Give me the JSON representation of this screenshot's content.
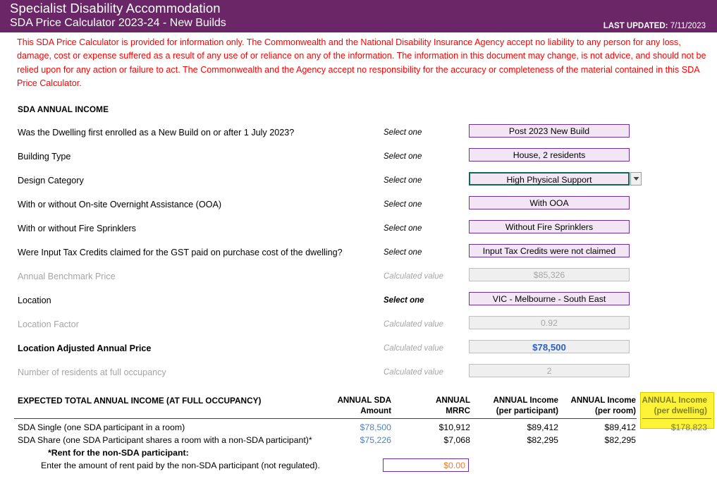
{
  "header": {
    "title": "Specialist Disability Accommodation",
    "subtitle": "SDA Price Calculator 2023-24 - New Builds",
    "last_updated_label": "LAST UPDATED:",
    "last_updated_value": "7/11/2023",
    "banner_color": "#6B2668"
  },
  "disclaimer": "This SDA Price Calculator is provided for information only.  The Commonwealth and the National Disability Insurance Agency accept no liability to any person for any loss, damage, cost or expense suffered as a result of any use of or reliance on any of the information.  The information in this document may change, is not advice, and should not be relied upon for any action or failure to act. The Commonwealth and the Agency accept no responsibility for the accuracy or completeness of the material contained in this SDA Price Calculator.",
  "section": {
    "heading": "SDA ANNUAL INCOME"
  },
  "hints": {
    "select_one": "Select one",
    "calculated_value": "Calculated value"
  },
  "form_rows": [
    {
      "label": "Was the Dwelling first enrolled as a New Build on or after 1 July 2023?",
      "hint": "Select one",
      "value": "Post 2023 New Build"
    },
    {
      "label": "Building Type",
      "hint": "Select one",
      "value": "House, 2 residents"
    },
    {
      "label": "Design Category",
      "hint": "Select one",
      "value": "High Physical Support"
    },
    {
      "label": "With or without On-site Overnight Assistance (OOA)",
      "hint": "Select one",
      "value": "With OOA"
    },
    {
      "label": "With or without Fire Sprinklers",
      "hint": "Select one",
      "value": "Without Fire Sprinklers"
    },
    {
      "label": "Were Input Tax Credits claimed for the GST paid on purchase cost of the dwelling?",
      "hint": "Select one",
      "value": "Input Tax Credits were not claimed"
    },
    {
      "label": "Annual Benchmark Price",
      "hint": "Calculated value",
      "value": "$85,326"
    },
    {
      "label": "Location",
      "hint": "Select one",
      "value": "VIC - Melbourne - South East"
    },
    {
      "label": "Location Factor",
      "hint": "Calculated value",
      "value": "0.92"
    },
    {
      "label": "Location Adjusted Annual Price",
      "hint": "Calculated value",
      "value": "$78,500"
    },
    {
      "label": "Number of residents at full occupancy",
      "hint": "Calculated value",
      "value": "2"
    }
  ],
  "table": {
    "title": "EXPECTED TOTAL ANNUAL INCOME (AT FULL OCCUPANCY)",
    "columns": [
      {
        "line1": "ANNUAL SDA",
        "line2": "Amount"
      },
      {
        "line1": "ANNUAL",
        "line2": "MRRC"
      },
      {
        "line1": "ANNUAL Income",
        "line2": "(per participant)"
      },
      {
        "line1": "ANNUAL Income",
        "line2": "(per room)"
      },
      {
        "line1": "ANNUAL Income",
        "line2": "(per dwelling)"
      }
    ],
    "rows": [
      {
        "label": "SDA Single (one SDA participant in a room)",
        "sda_amount": "$78,500",
        "mrrc": "$10,912",
        "per_participant": "$89,412",
        "per_room": "$89,412",
        "per_dwelling": "$178,823"
      },
      {
        "label": "SDA Share (one SDA Participant shares a room with a non-SDA participant)*",
        "sda_amount": "$75,226",
        "mrrc": "$7,068",
        "per_participant": "$82,295",
        "per_room": "$82,295",
        "per_dwelling": ""
      }
    ],
    "rent_heading": "*Rent for the non-SDA participant:",
    "rent_subtext": "Enter the amount of rent paid by the non-SDA participant (not regulated).",
    "rent_value": "$0.00"
  },
  "colors": {
    "banner": "#6B2668",
    "disclaimer_text": "#FF0000",
    "select_fill": "#F2E6F5",
    "select_border": "#7030A0",
    "calc_fill": "#EFEFEF",
    "accent_blue": "#2B5FC4",
    "highlight_yellow": "#FFF338",
    "selection_green": "#0E6B52",
    "rent_orange": "#ED7D31"
  }
}
